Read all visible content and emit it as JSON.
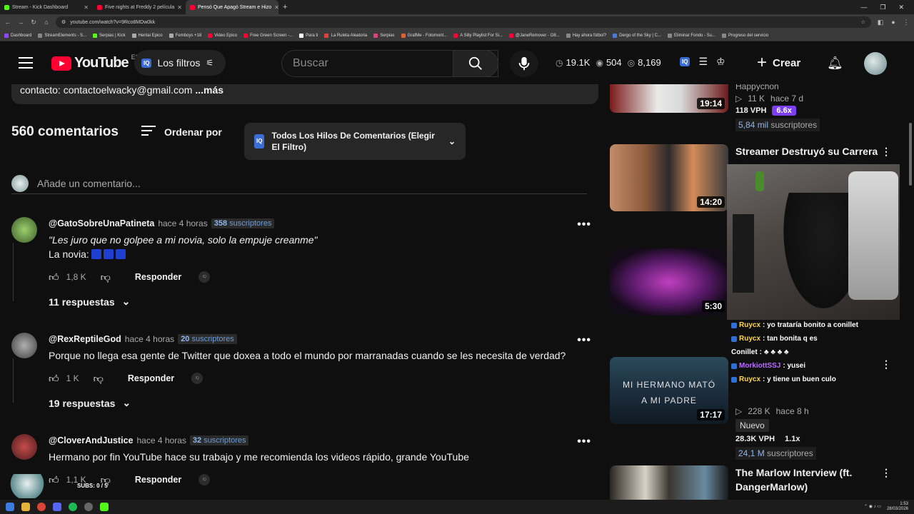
{
  "browser": {
    "tabs": [
      {
        "title": "Stream - Kick Dashboard",
        "color": "#53fc18"
      },
      {
        "title": "Five nights at Freddy 2 película",
        "color": "#ff0033"
      },
      {
        "title": "Pensó Que Apagó Stream e Hizo",
        "color": "#ff0033"
      }
    ],
    "url": "youtube.com/watch?v=9Rco8MDw0kk",
    "bookmarks": [
      "Dashboard",
      "StreamElements - S...",
      "Serpias | Kick",
      "Hentai Epico",
      "Femboys +18",
      "Video Epico",
      "Free Green Screen -...",
      "Para ti",
      "La Ruleta Aleatoria",
      "Serpias",
      "GrafMe - Fotomont...",
      "A Silly Playlist For Si...",
      "@JaneRemover - O8...",
      "Hay ahora fútbol?",
      "Dergo of the Sky | C...",
      "Eliminar Fondo - Su...",
      "Progreso del servicio"
    ]
  },
  "header": {
    "logo_text": "YouTube",
    "country": "ES",
    "filters_label": "Los filtros",
    "search_placeholder": "Buscar",
    "stats": {
      "views_rate": "19.1K",
      "watching": "504",
      "total": "8,169"
    },
    "create_label": "Crear"
  },
  "description": {
    "text": "contacto: contactoelwacky@gmail.com",
    "more": "...más"
  },
  "comments_header": {
    "count": "560 comentarios",
    "sort_label": "Ordenar por",
    "threads_label": "Todos Los Hilos De Comentarios (Elegir El Filtro)",
    "add_placeholder": "Añade un comentario..."
  },
  "comments": [
    {
      "author": "@GatoSobreUnaPatineta",
      "time": "hace 4 horas",
      "subs_num": "358",
      "subs_word": "suscriptores",
      "line1": "\"Les juro que no golpee a mi novia, solo la empuje creanme\"",
      "line2": "La novia:",
      "likes": "1,8 K",
      "reply": "Responder",
      "replies": "11 respuestas"
    },
    {
      "author": "@RexReptileGod",
      "time": "hace 4 horas",
      "subs_num": "20",
      "subs_word": "suscriptores",
      "line1": "Porque no llega esa gente de Twitter que doxea a todo el mundo por marranadas cuando se les necesita de verdad?",
      "likes": "1 K",
      "reply": "Responder",
      "replies": "19 respuestas"
    },
    {
      "author": "@CloverAndJustice",
      "time": "hace 4 horas",
      "subs_num": "32",
      "subs_word": "suscriptores",
      "line1": "Hermano por fin YouTube hace su trabajo y me recomienda los videos rápido, grande YouTube",
      "likes": "1,1 K",
      "reply": "Responder"
    }
  ],
  "sidebar": [
    {
      "title": "",
      "channel": "Happychon",
      "views": "11 K",
      "age": "hace 7 d",
      "vph": "118 VPH",
      "mult": "6.6x",
      "subs": "5,84 mil",
      "subs_word": "suscriptores",
      "duration": "19:14"
    },
    {
      "title": "Streamer Destruyó su Carrera",
      "duration": "14:20"
    },
    {
      "duration": "5:30"
    },
    {
      "duration": "17:17",
      "thumb_text_1": "MI HERMANO MATÓ",
      "thumb_text_2": "A MI PADRE",
      "views": "228 K",
      "age": "hace 8 h",
      "badge": "Nuevo",
      "vph": "28.3K VPH",
      "mult": "1.1x",
      "subs": "24,1 M",
      "subs_word": "suscriptores"
    },
    {
      "title": "The Marlow Interview (ft. DangerMarlow)"
    }
  ],
  "chat": [
    {
      "user": "Ruycx",
      "msg": ": yo trataría bonito a conillet"
    },
    {
      "user": "Ruycx",
      "msg": ": tan bonita q es"
    },
    {
      "user": "Conillet",
      "msg": ":"
    },
    {
      "user": "MorkiottSSJ",
      "msg": ": yusei"
    },
    {
      "user": "Ruycx",
      "msg": ": y tiene un buen culo"
    }
  ],
  "overlay": {
    "subs_goal": "SUBS: 0 / 5"
  },
  "taskbar": {
    "time": "1:53",
    "date": "28/03/2026"
  }
}
